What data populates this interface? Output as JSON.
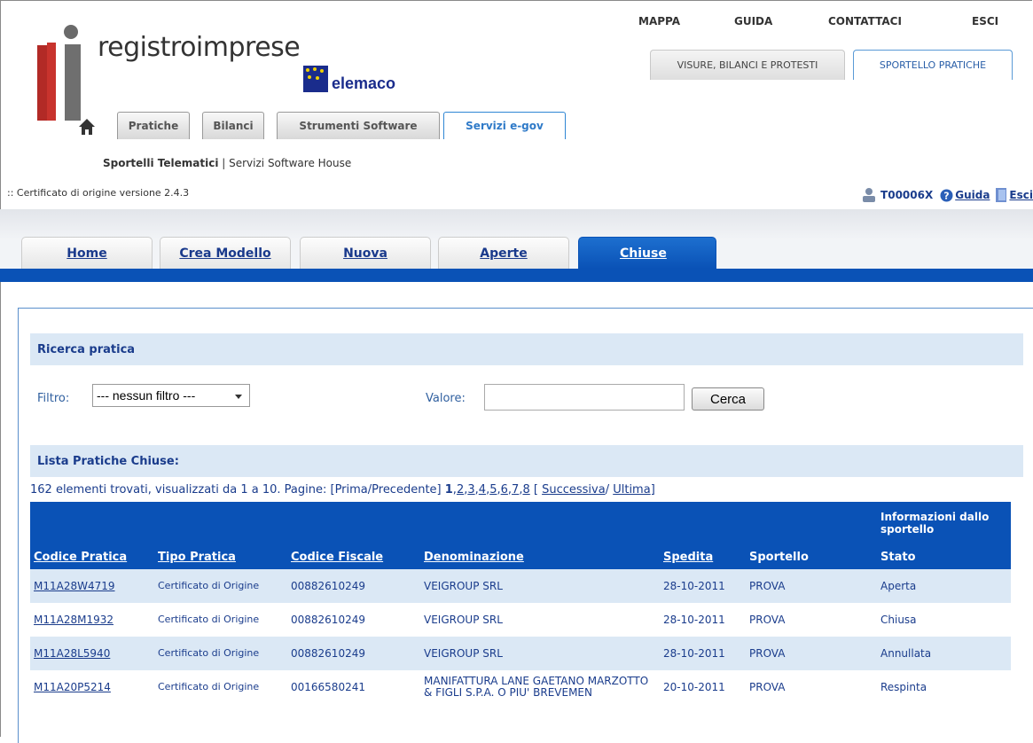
{
  "topnav": {
    "mappa": "MAPPA",
    "guida": "GUIDA",
    "contattaci": "CONTATTACI",
    "esci": "ESCI"
  },
  "logo": {
    "text": "registroimprese",
    "partner": "Telemaco",
    "partner_rest": "elemaco"
  },
  "portal_tabs": [
    {
      "label": "VISURE, BILANCI E PROTESTI",
      "active": false
    },
    {
      "label": "SPORTELLO PRATICHE",
      "active": true
    }
  ],
  "main_tabs": [
    {
      "label": "Pratiche"
    },
    {
      "label": "Bilanci"
    },
    {
      "label": "Strumenti Software"
    },
    {
      "label": "Servizi e-gov",
      "active": true
    }
  ],
  "subnav": {
    "active": "Sportelli Telematici",
    "sep": " | ",
    "other": "Servizi Software House"
  },
  "version": ":: Certificato di origine versione 2.4.3",
  "user": {
    "id": "T00006X",
    "guida": "Guida",
    "esci": "Esci"
  },
  "app_tabs": [
    {
      "label": "Home"
    },
    {
      "label": "Crea Modello"
    },
    {
      "label": "Nuova"
    },
    {
      "label": "Aperte"
    },
    {
      "label": "Chiuse",
      "active": true
    }
  ],
  "search": {
    "title": "Ricerca pratica",
    "filter_label": "Filtro:",
    "filter_value": "--- nessun filtro ---",
    "value_label": "Valore:",
    "value": "",
    "button": "Cerca"
  },
  "list": {
    "title": "Lista Pratiche Chiuse:",
    "paging": {
      "summary": "162 elementi trovati, visualizzati da 1 a 10. Pagine: [Prima/Precedente] ",
      "current": "1",
      "pages": [
        "2",
        "3",
        "4",
        "5",
        "6",
        "7",
        "8"
      ],
      "open": " [ ",
      "next": "Successiva",
      "slash": "/ ",
      "last": "Ultima",
      "close": "]"
    },
    "header_group": "Informazioni dallo sportello",
    "columns": [
      "Codice Pratica",
      "Tipo Pratica",
      "Codice Fiscale",
      "Denominazione",
      "Spedita",
      "Sportello",
      "Stato"
    ],
    "rows": [
      {
        "codice": "M11A28W4719",
        "tipo": "Certificato di Origine",
        "cf": "00882610249",
        "denominazione": "VEIGROUP SRL",
        "spedita": "28-10-2011",
        "sportello": "PROVA",
        "stato": "Aperta"
      },
      {
        "codice": "M11A28M1932",
        "tipo": "Certificato di Origine",
        "cf": "00882610249",
        "denominazione": "VEIGROUP SRL",
        "spedita": "28-10-2011",
        "sportello": "PROVA",
        "stato": "Chiusa"
      },
      {
        "codice": "M11A28L5940",
        "tipo": "Certificato di Origine",
        "cf": "00882610249",
        "denominazione": "VEIGROUP SRL",
        "spedita": "28-10-2011",
        "sportello": "PROVA",
        "stato": "Annullata"
      },
      {
        "codice": "M11A20P5214",
        "tipo": "Certificato di Origine",
        "cf": "00166580241",
        "denominazione": "MANIFATTURA LANE GAETANO MARZOTTO & FIGLI S.P.A. O PIU' BREVEMEN",
        "spedita": "20-10-2011",
        "sportello": "PROVA",
        "stato": "Respinta"
      }
    ]
  },
  "colors": {
    "accent": "#0a52b6",
    "section_bg": "#dbe8f5",
    "link": "#1a3c8c"
  }
}
